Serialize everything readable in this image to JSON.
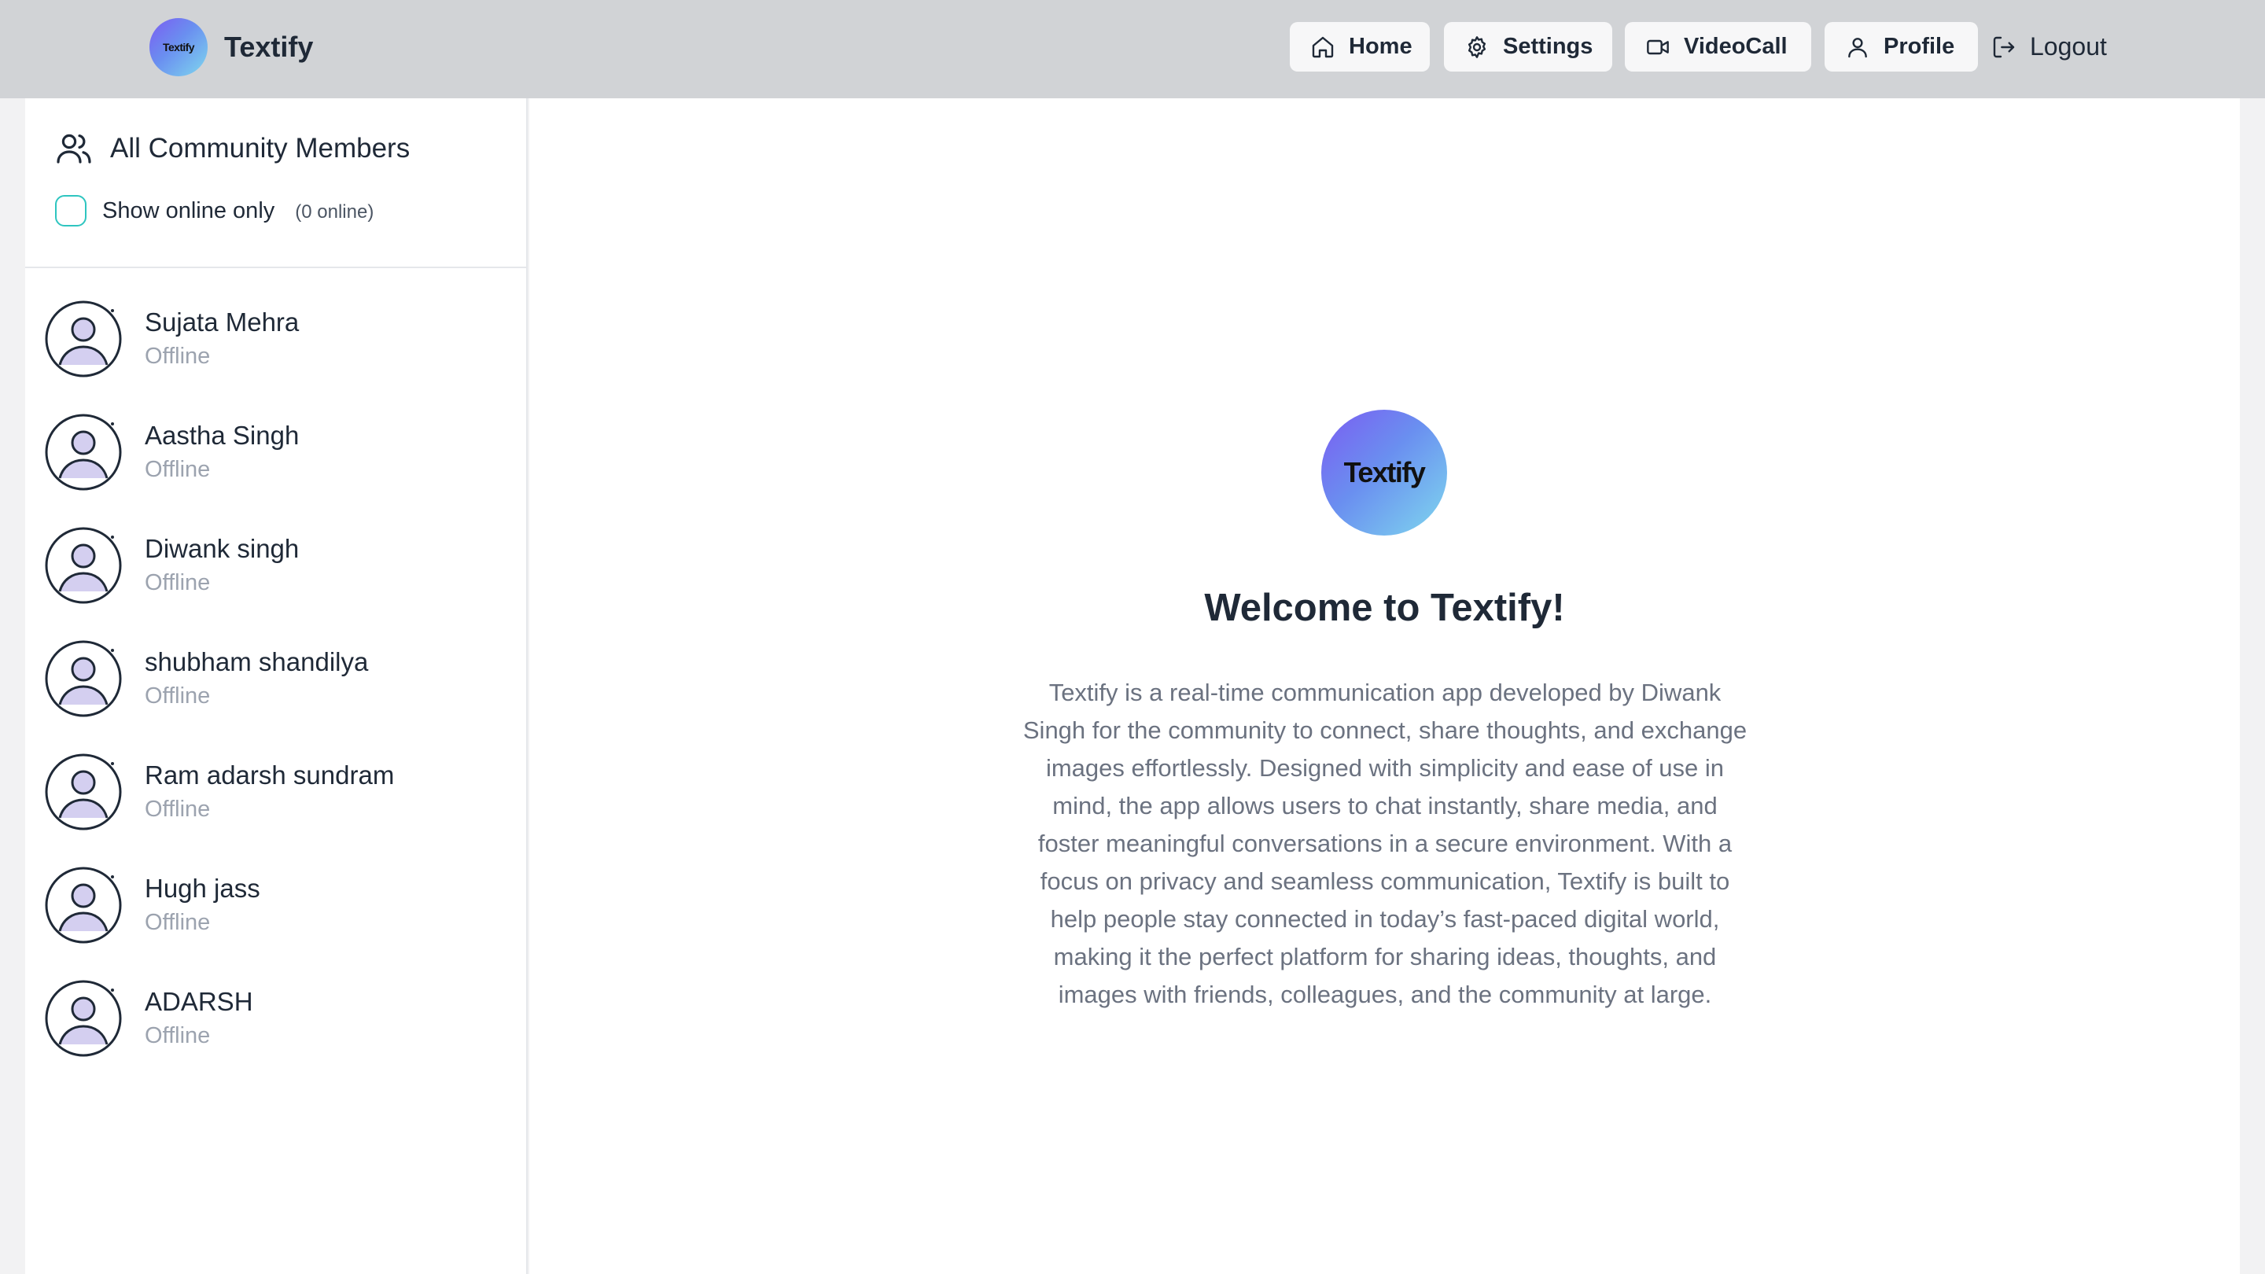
{
  "brand": {
    "logo_text": "Textify",
    "name": "Textify"
  },
  "nav": {
    "home": "Home",
    "settings": "Settings",
    "videocall": "VideoCall",
    "profile": "Profile",
    "logout": "Logout"
  },
  "sidebar": {
    "title": "All Community Members",
    "online_toggle_label": "Show online only",
    "online_count": "(0 online)",
    "members": [
      {
        "name": "Sujata Mehra",
        "status": "Offline"
      },
      {
        "name": "Aastha Singh",
        "status": "Offline"
      },
      {
        "name": "Diwank singh",
        "status": "Offline"
      },
      {
        "name": "shubham shandilya",
        "status": "Offline"
      },
      {
        "name": "Ram adarsh sundram",
        "status": "Offline"
      },
      {
        "name": "Hugh jass",
        "status": "Offline"
      },
      {
        "name": "ADARSH",
        "status": "Offline"
      }
    ]
  },
  "welcome": {
    "logo_text": "Textify",
    "title": "Welcome to Textify!",
    "body": "Textify is a real-time communication app developed by Diwank Singh for the community to connect, share thoughts, and exchange images effortlessly. Designed with simplicity and ease of use in mind, the app allows users to chat instantly, share media, and foster meaningful conversations in a secure environment. With a focus on privacy and seamless communication, Textify is built to help people stay connected in today’s fast-paced digital world, making it the perfect platform for sharing ideas, thoughts, and images with friends, colleagues, and the community at large."
  },
  "icons": {
    "home": "home-icon",
    "settings": "gear-icon",
    "videocall": "video-camera-icon",
    "profile": "user-icon",
    "logout": "logout-icon",
    "members": "users-icon",
    "avatar": "user-avatar-icon"
  },
  "colors": {
    "navbar_bg": "#d1d3d6",
    "checkbox_border": "#2ec5c0",
    "logo_gradient_start": "#7b5cf2",
    "logo_gradient_end": "#7fd8ee",
    "avatar_fill": "#d4cff0",
    "status_text": "#9ca3af"
  }
}
